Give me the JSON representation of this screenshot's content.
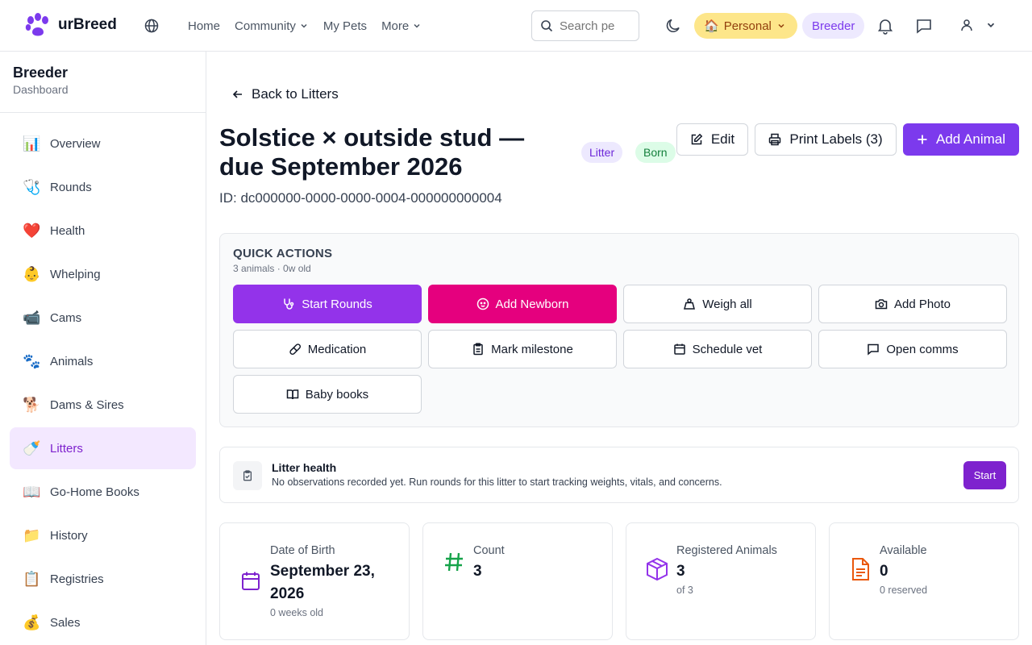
{
  "brand": {
    "name": "urBreed"
  },
  "nav": {
    "home": "Home",
    "community": "Community",
    "my_pets": "My Pets",
    "more": "More"
  },
  "search": {
    "placeholder": "Search pe"
  },
  "context": {
    "personal": "Personal",
    "breeder": "Breeder",
    "personal_emoji": "🏠"
  },
  "sidebar": {
    "title": "Breeder",
    "subtitle": "Dashboard",
    "items": [
      {
        "label": "Overview",
        "emoji": "📊"
      },
      {
        "label": "Rounds",
        "emoji": "🩺"
      },
      {
        "label": "Health",
        "emoji": "❤️"
      },
      {
        "label": "Whelping",
        "emoji": "👶"
      },
      {
        "label": "Cams",
        "emoji": "📹"
      },
      {
        "label": "Animals",
        "emoji": "🐾"
      },
      {
        "label": "Dams & Sires",
        "emoji": "🐕"
      },
      {
        "label": "Litters",
        "emoji": "🍼"
      },
      {
        "label": "Go-Home Books",
        "emoji": "📖"
      },
      {
        "label": "History",
        "emoji": "📁"
      },
      {
        "label": "Registries",
        "emoji": "📋"
      },
      {
        "label": "Sales",
        "emoji": "💰"
      }
    ]
  },
  "page": {
    "back": "Back to Litters",
    "title": "Solstice × outside stud — due September 2026",
    "badge_litter": "Litter",
    "badge_born": "Born",
    "edit": "Edit",
    "print_labels": "Print Labels (3)",
    "add_animal": "Add Animal",
    "id_line": "ID: dc000000-0000-0000-0004-000000000004"
  },
  "quick_actions": {
    "title": "QUICK ACTIONS",
    "subtitle": "3 animals · 0w old",
    "start_rounds": "Start Rounds",
    "add_newborn": "Add Newborn",
    "weigh_all": "Weigh all",
    "add_photo": "Add Photo",
    "medication": "Medication",
    "mark_milestone": "Mark milestone",
    "schedule_vet": "Schedule vet",
    "open_comms": "Open comms",
    "baby_books": "Baby books"
  },
  "health": {
    "title": "Litter health",
    "subtitle": "No observations recorded yet. Run rounds for this litter to start tracking weights, vitals, and concerns.",
    "start": "Start"
  },
  "stats": {
    "dob": {
      "label": "Date of Birth",
      "value": "September 23, 2026",
      "note": "0 weeks old"
    },
    "count": {
      "label": "Count",
      "value": "3"
    },
    "registered": {
      "label": "Registered Animals",
      "value": "3",
      "note": "of 3"
    },
    "available": {
      "label": "Available",
      "value": "0",
      "note": "0 reserved"
    }
  }
}
